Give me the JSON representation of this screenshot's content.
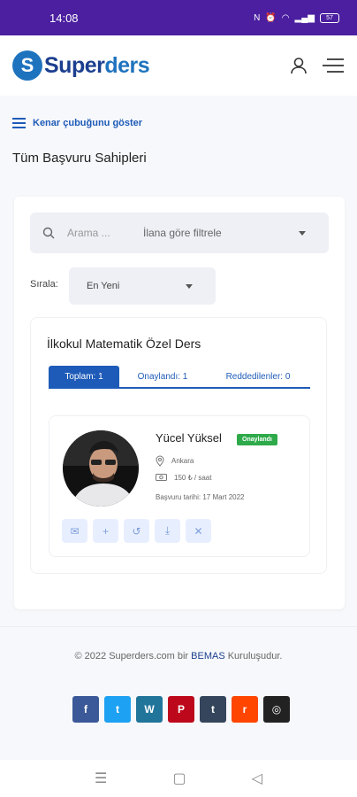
{
  "status_bar": {
    "time": "14:08",
    "battery": "57"
  },
  "header": {
    "logo_letter": "S",
    "logo_text_a": "Super",
    "logo_text_b": "ders"
  },
  "sidebar_toggle": {
    "label": "Kenar çubuğunu göster"
  },
  "page": {
    "title": "Tüm Başvuru Sahipleri"
  },
  "search": {
    "placeholder": "Arama ...",
    "filter_label": "İlana göre filtrele"
  },
  "sort": {
    "label": "Sırala:",
    "value": "En Yeni"
  },
  "listing": {
    "title": "İlkokul Matematik Özel Ders",
    "tabs": [
      {
        "label": "Toplam: 1"
      },
      {
        "label": "Onaylandı: 1"
      },
      {
        "label": "Reddedilenler: 0"
      }
    ]
  },
  "applicant": {
    "name": "Yücel Yüksel",
    "status": "Onaylandı",
    "city": "Ankara",
    "price": "150 ₺ / saat",
    "applied": "Başvuru tarihi: 17 Mart 2022"
  },
  "footer": {
    "copyright_before": "© 2022 Superders.com bir ",
    "brand": "BEMAS",
    "copyright_after": " Kuruluşudur."
  },
  "social": [
    {
      "icon": "facebook-icon",
      "glyph": "f",
      "color": "#3b5998"
    },
    {
      "icon": "twitter-icon",
      "glyph": "t",
      "color": "#1da1f2"
    },
    {
      "icon": "wordpress-icon",
      "glyph": "W",
      "color": "#21759b"
    },
    {
      "icon": "pinterest-icon",
      "glyph": "P",
      "color": "#bd081c"
    },
    {
      "icon": "tumblr-icon",
      "glyph": "t",
      "color": "#35465c"
    },
    {
      "icon": "reddit-icon",
      "glyph": "r",
      "color": "#ff4500"
    },
    {
      "icon": "instagram-icon",
      "glyph": "◎",
      "color": "#222222"
    }
  ],
  "colors": {
    "primary": "#1e5bb8",
    "status_bar": "#4b1fa0",
    "approved": "#2eaa4a"
  }
}
